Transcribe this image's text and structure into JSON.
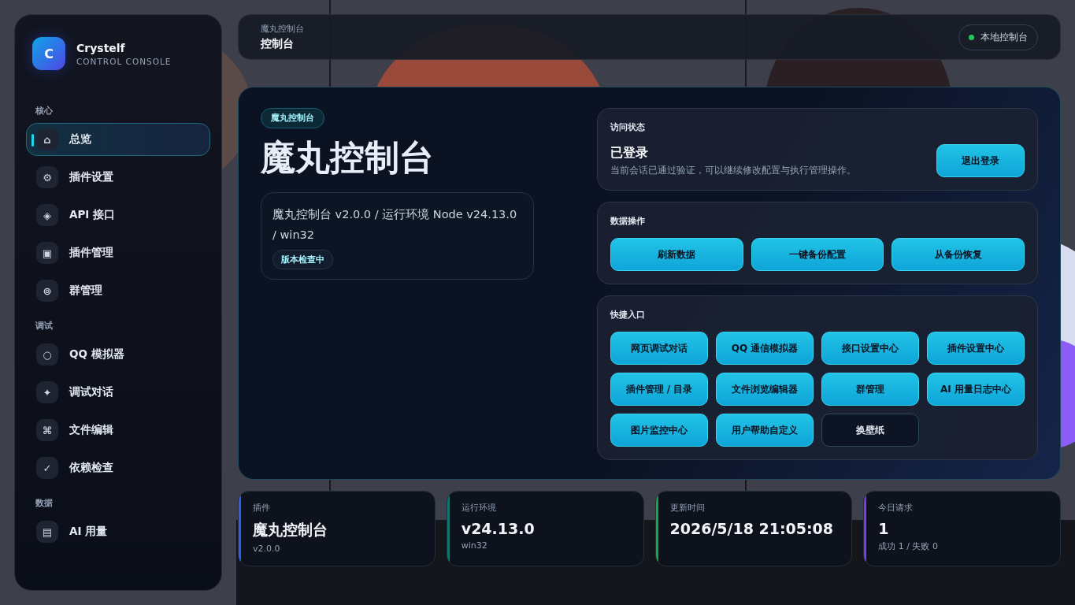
{
  "brand": {
    "logo": "C",
    "name": "Crystelf",
    "subtitle": "CONTROL CONSOLE"
  },
  "sidebar": {
    "sections": [
      {
        "title": "核心",
        "items": [
          {
            "icon": "⌂",
            "label": "总览",
            "selected": true
          },
          {
            "icon": "⚙",
            "label": "插件设置",
            "selected": false
          },
          {
            "icon": "◈",
            "label": "API 接口",
            "selected": false
          },
          {
            "icon": "▣",
            "label": "插件管理",
            "selected": false
          },
          {
            "icon": "⊚",
            "label": "群管理",
            "selected": false
          }
        ]
      },
      {
        "title": "调试",
        "items": [
          {
            "icon": "○",
            "label": "QQ 模拟器",
            "selected": false
          },
          {
            "icon": "✦",
            "label": "调试对话",
            "selected": false
          },
          {
            "icon": "⌘",
            "label": "文件编辑",
            "selected": false
          },
          {
            "icon": "✓",
            "label": "依赖检查",
            "selected": false
          }
        ]
      },
      {
        "title": "数据",
        "items": [
          {
            "icon": "▤",
            "label": "AI 用量",
            "selected": false
          }
        ]
      }
    ]
  },
  "topbar": {
    "crumb": "魔丸控制台",
    "title": "控制台",
    "status": {
      "label": "本地控制台",
      "color": "#22c55e"
    }
  },
  "hero": {
    "badge": "魔丸控制台",
    "title": "魔丸控制台",
    "info": "魔丸控制台 v2.0.0 / 运行环境 Node v24.13.0 / win32",
    "info_badge": "版本检查中"
  },
  "access": {
    "title": "访问状态",
    "state": "已登录",
    "note": "当前会话已通过验证，可以继续修改配置与执行管理操作。",
    "button": "退出登录"
  },
  "data_ops": {
    "title": "数据操作",
    "buttons": [
      "刷新数据",
      "一键备份配置",
      "从备份恢复"
    ]
  },
  "shortcuts": {
    "title": "快捷入口",
    "buttons": [
      {
        "label": "网页调试对话",
        "kind": "filled"
      },
      {
        "label": "QQ 通信模拟器",
        "kind": "filled"
      },
      {
        "label": "接口设置中心",
        "kind": "filled"
      },
      {
        "label": "插件设置中心",
        "kind": "filled"
      },
      {
        "label": "插件管理 / 目录",
        "kind": "filled"
      },
      {
        "label": "文件浏览编辑器",
        "kind": "filled"
      },
      {
        "label": "群管理",
        "kind": "filled"
      },
      {
        "label": "AI 用量日志中心",
        "kind": "filled"
      },
      {
        "label": "图片监控中心",
        "kind": "filled"
      },
      {
        "label": "用户帮助自定义",
        "kind": "filled"
      },
      {
        "label": "换壁纸",
        "kind": "outline"
      }
    ]
  },
  "stats": [
    {
      "label": "插件",
      "value": "魔丸控制台",
      "sub": "v2.0.0",
      "color": "#2563eb"
    },
    {
      "label": "运行环境",
      "value": "v24.13.0",
      "sub": "win32",
      "color": "#0f766e"
    },
    {
      "label": "更新时间",
      "value": "2026/5/18 21:05:08",
      "color": "#16a34a"
    },
    {
      "label": "今日请求",
      "value": "1",
      "sub": "成功 1 / 失败 0",
      "color": "#7c3aed"
    }
  ]
}
